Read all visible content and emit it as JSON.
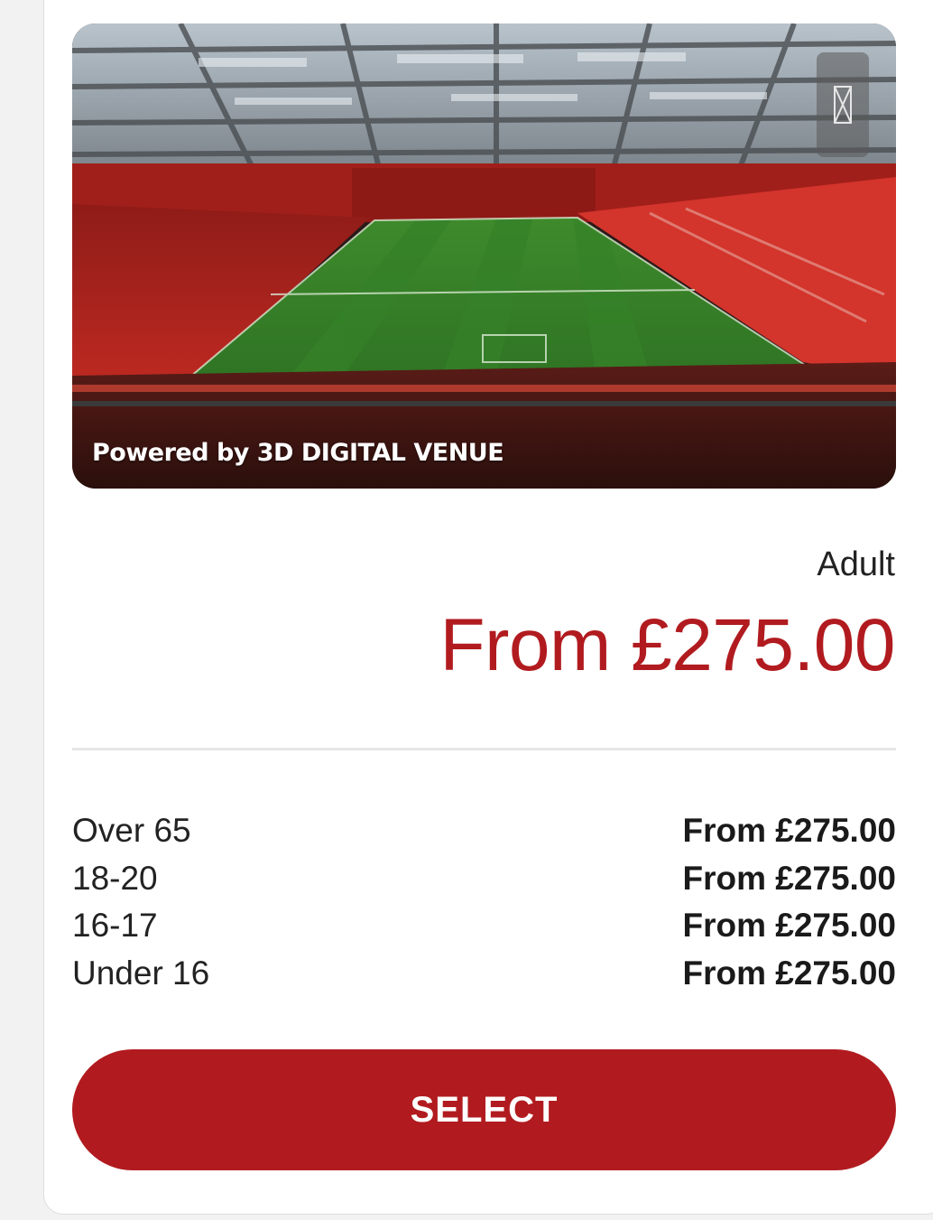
{
  "venue_view": {
    "credit": "Powered by 3D DIGITAL VENUE",
    "expand_icon": "fullscreen-icon"
  },
  "pricing": {
    "primary": {
      "label": "Adult",
      "price": "From £275.00"
    },
    "others": [
      {
        "category": "Over 65",
        "price": "From £275.00"
      },
      {
        "category": "18-20",
        "price": "From £275.00"
      },
      {
        "category": "16-17",
        "price": "From £275.00"
      },
      {
        "category": "Under 16",
        "price": "From £275.00"
      }
    ]
  },
  "actions": {
    "select_label": "SELECT"
  },
  "colors": {
    "accent": "#b11b1f",
    "pitch": "#3f8a2e",
    "seats": "#c62a22"
  }
}
